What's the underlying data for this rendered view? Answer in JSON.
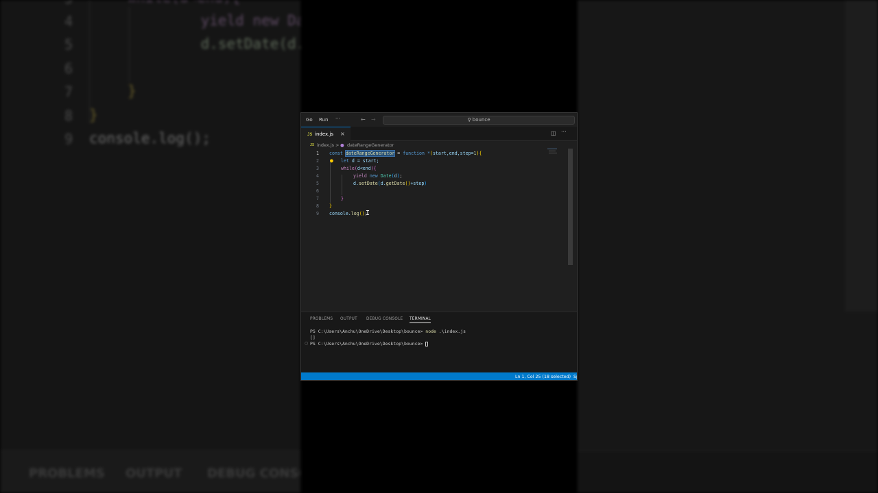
{
  "background_left": {
    "line_numbers": [
      "5",
      "4",
      "5",
      "6",
      "7",
      "8",
      "9"
    ],
    "code_lines": [
      {
        "indent": "while(d<end){"
      },
      {
        "indent": "    yield new Date"
      },
      {
        "indent": "    d.setDate(d.ge"
      },
      {
        "indent": ""
      },
      {
        "indent": "}"
      },
      {
        "indent": "}"
      },
      {
        "indent": "console.log();"
      }
    ],
    "panel_tabs": [
      "PROBLEMS",
      "OUTPUT",
      "DEBUG CONSO"
    ]
  },
  "titlebar": {
    "menu_go": "Go",
    "menu_run": "Run",
    "menu_more": "···",
    "search": "bounce"
  },
  "tab": {
    "badge": "JS",
    "label": "index.js",
    "close": "×"
  },
  "breadcrumb": {
    "file": "index.js",
    "separator": ">",
    "symbol": "dateRangeGenerator"
  },
  "editor": {
    "line_numbers": [
      "1",
      "2",
      "3",
      "4",
      "5",
      "6",
      "7",
      "8",
      "9"
    ],
    "line1": {
      "kw": "const",
      "name": "dateRangeGenerator",
      "rest1": " = ",
      "fn_kw": "function",
      "star": " *",
      "open": "(",
      "params": "start,end,step=",
      "num": "1",
      "close": ")",
      "brace": "{"
    },
    "line2": {
      "kw": "let",
      "rest": " d = start;"
    },
    "line3": {
      "kw": "while",
      "open": "(",
      "cond": "d<end",
      "close": ")",
      "brace": "{"
    },
    "line4": {
      "kw": "yield",
      "kw2": "new",
      "cls": "Date",
      "open": "(",
      "arg": "d",
      "close": ")",
      "semi": ";"
    },
    "line5": {
      "obj": "d.",
      "fn": "setDate",
      "open": "(",
      "obj2": "d.",
      "fn2": "getDate",
      "call": "()",
      "rest": "+step",
      "close": ")"
    },
    "line7": {
      "brace": "}"
    },
    "line8": {
      "brace": "}"
    },
    "line9": {
      "obj": "console.",
      "fn": "log",
      "open": "(",
      "close": ")",
      "semi": ";"
    }
  },
  "panel": {
    "tabs": [
      "PROBLEMS",
      "OUTPUT",
      "DEBUG CONSOLE",
      "TERMINAL"
    ],
    "active_tab": "TERMINAL",
    "terminal": {
      "line1_prompt": "PS C:\\Users\\Anchu\\OneDrive\\Desktop\\bounce> ",
      "line1_cmd": "node",
      "line1_arg": " .\\index.js",
      "line2": "[]",
      "line3_prompt": "PS C:\\Users\\Anchu\\OneDrive\\Desktop\\bounce> "
    }
  },
  "statusbar": {
    "position": "Ln 1, Col 25 (18 selected)",
    "spaces": "Sp"
  },
  "colors": {
    "accent": "#007acc",
    "editor_bg": "#1f1f1f",
    "selection": "#264f78"
  }
}
